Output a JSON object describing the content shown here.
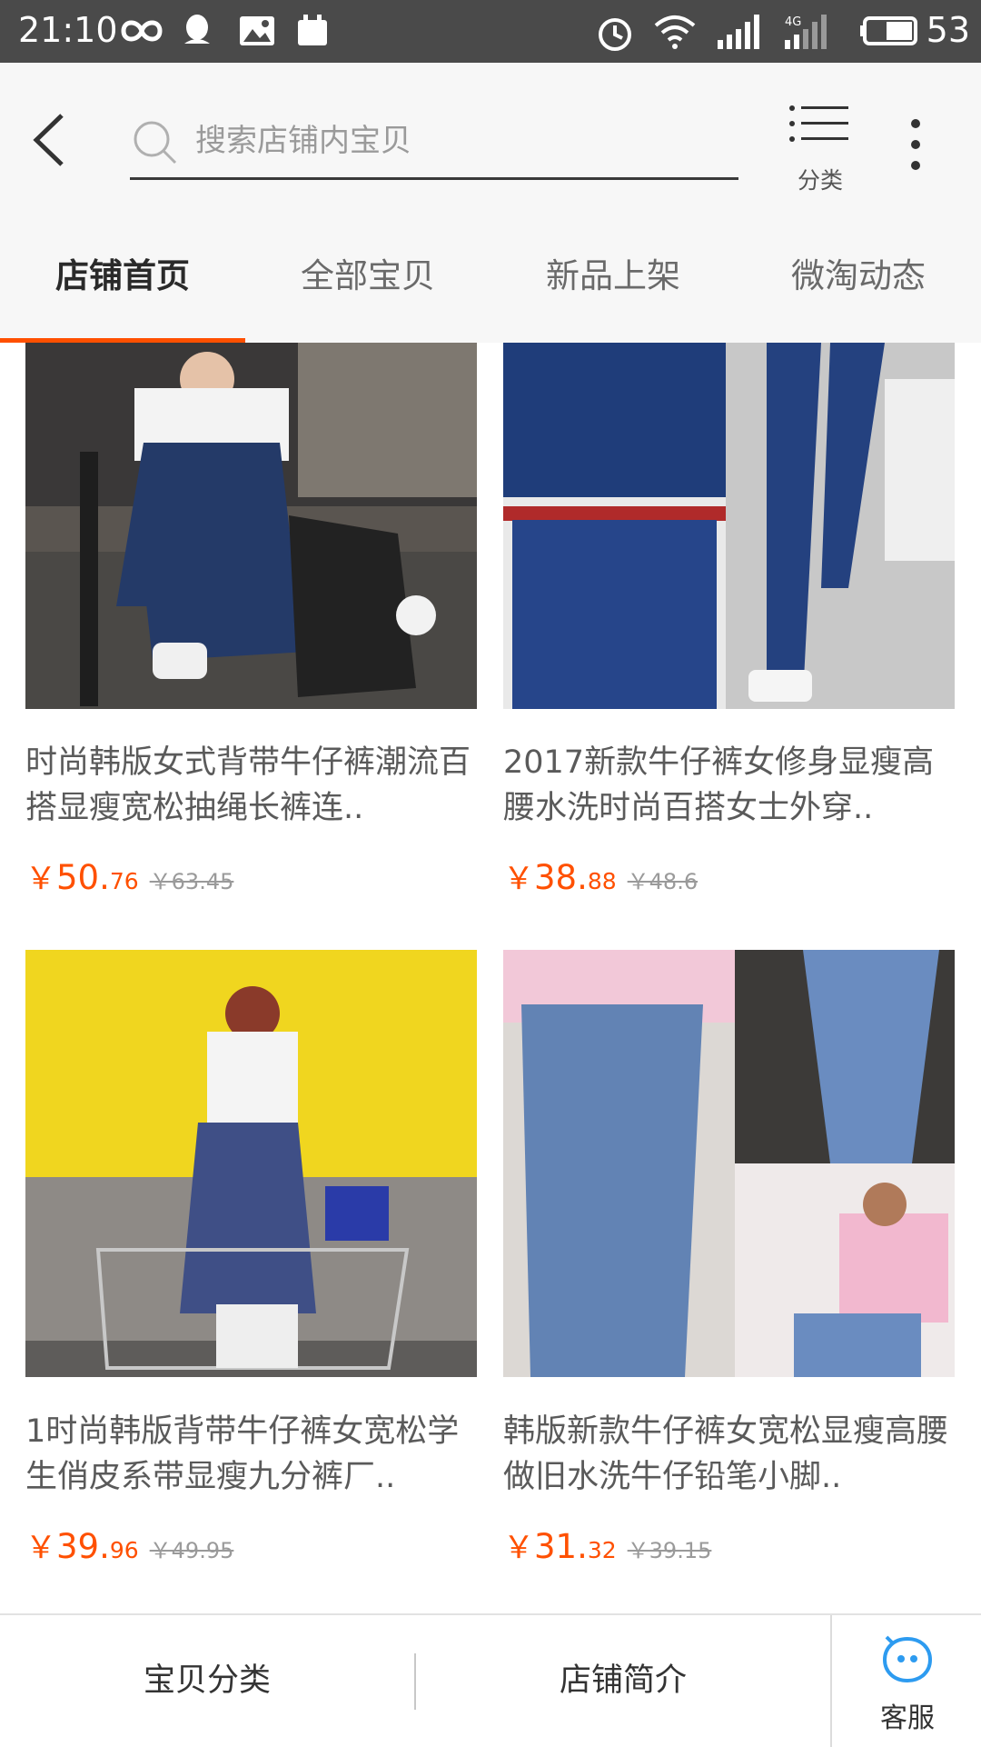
{
  "status_bar": {
    "time": "21:10",
    "network": "4G",
    "battery": "53",
    "icons": [
      "infinity-icon",
      "qq-icon",
      "image-icon",
      "calendar-icon",
      "alarm-icon",
      "wifi-icon",
      "signal-icon",
      "signal-4g-icon",
      "battery-icon"
    ]
  },
  "header": {
    "back_icon": "chevron-left-icon",
    "search_placeholder": "搜索店铺内宝贝",
    "category_label": "分类",
    "more_icon": "more-vertical-icon"
  },
  "tabs": [
    {
      "label": "店铺首页",
      "active": true
    },
    {
      "label": "全部宝贝",
      "active": false
    },
    {
      "label": "新品上架",
      "active": false
    },
    {
      "label": "微淘动态",
      "active": false
    }
  ],
  "products": [
    {
      "title": "时尚韩版女式背带牛仔裤潮流百搭显瘦宽松抽绳长裤连..",
      "price_yuan": "￥",
      "price_int": "50.",
      "price_dec": "76",
      "price_original": "￥63.45"
    },
    {
      "title": "2017新款牛仔裤女修身显瘦高腰水洗时尚百搭女士外穿..",
      "price_yuan": "￥",
      "price_int": "38.",
      "price_dec": "88",
      "price_original": "￥48.6"
    },
    {
      "title": "1时尚韩版背带牛仔裤女宽松学生俏皮系带显瘦九分裤厂..",
      "price_yuan": "￥",
      "price_int": "39.",
      "price_dec": "96",
      "price_original": "￥49.95"
    },
    {
      "title": "韩版新款牛仔裤女宽松显瘦高腰做旧水洗牛仔铅笔小脚..",
      "price_yuan": "￥",
      "price_int": "31.",
      "price_dec": "32",
      "price_original": "￥39.15"
    }
  ],
  "bottom_bar": {
    "categories_label": "宝贝分类",
    "intro_label": "店铺简介",
    "service_label": "客服"
  },
  "colors": {
    "accent": "#ff5000",
    "status_bar": "#4a4a4a",
    "header_bg": "#f7f7f7",
    "service_icon": "#2d9bf0"
  }
}
